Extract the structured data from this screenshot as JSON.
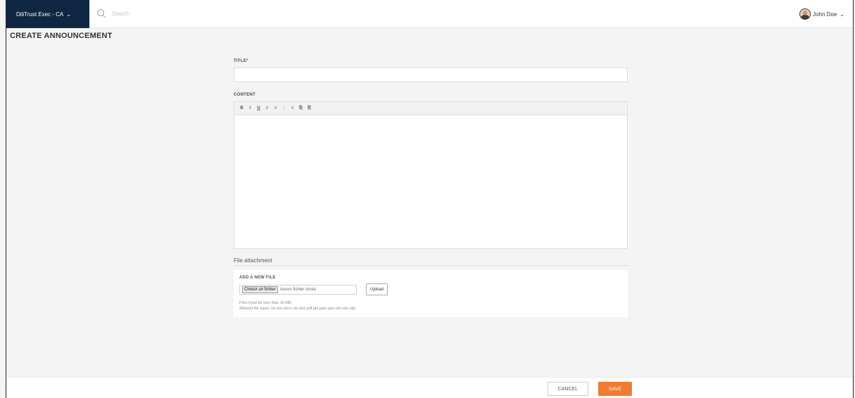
{
  "topbar": {
    "org_label": "DiliTrust Exec - CA",
    "search_placeholder": "Search",
    "user_name": "John Doe"
  },
  "page": {
    "title": "CREATE ANNOUNCEMENT"
  },
  "form": {
    "title_label": "TITLE",
    "title_required_mark": "*",
    "title_value": "",
    "content_label": "CONTENT",
    "toolbar": [
      "B",
      "I",
      "U",
      "≡",
      "≡",
      "≡",
      "≡",
      "⎘",
      "⎘"
    ],
    "attachment_heading": "File attachment",
    "add_file_label": "ADD A NEW FILE",
    "choose_file_label": "Choisir un fichier",
    "no_file_label": "Aucun fichier choisi",
    "upload_label": "Upload",
    "size_hint": "Files must be less than 15 MB.",
    "types_hint": "Allowed file types: txt doc docx xls xlsx pdf ppt pptx pps odt ods odp."
  },
  "footer": {
    "cancel_label": "CANCEL",
    "save_label": "SAVE"
  },
  "colors": {
    "brand_navy": "#0f2742",
    "accent_orange": "#f07c32",
    "required_red": "#e53935"
  },
  "icons": {
    "search": "search-icon",
    "chevron": "chevron-down-icon",
    "avatar": "avatar"
  }
}
